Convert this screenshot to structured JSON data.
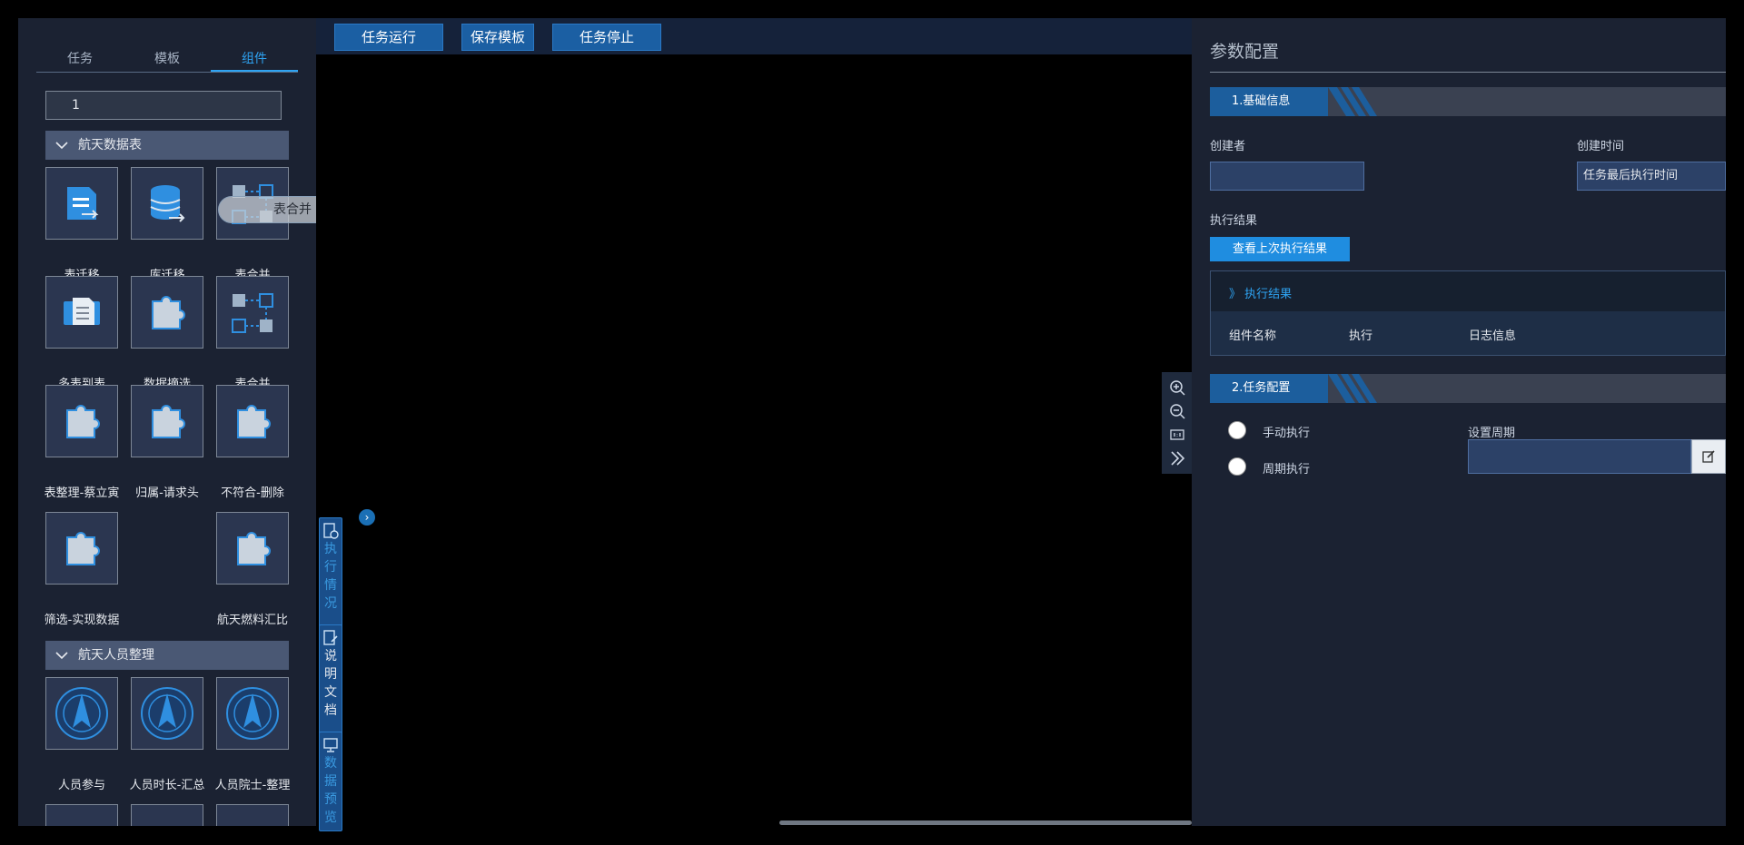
{
  "left_panel": {
    "tabs": [
      {
        "label": "任务"
      },
      {
        "label": "模板"
      },
      {
        "label": "组件"
      }
    ],
    "search_value": "1",
    "groups": [
      {
        "title": "航天数据表"
      },
      {
        "title": "航天人员整理"
      }
    ],
    "components": [
      {
        "label": "表迁移",
        "icon": "table-migrate-icon"
      },
      {
        "label": "库迁移",
        "icon": "database-migrate-icon"
      },
      {
        "label": "表合并",
        "icon": "table-merge-icon"
      },
      {
        "label": "多表到表",
        "icon": "multi-table-icon"
      },
      {
        "label": "数据摘选",
        "icon": "puzzle-icon"
      },
      {
        "label": "表合并",
        "icon": "table-merge-icon"
      },
      {
        "label": "表整理-蔡立寅",
        "icon": "puzzle-icon"
      },
      {
        "label": "归属-请求头",
        "icon": "puzzle-icon"
      },
      {
        "label": "不符合-删除",
        "icon": "puzzle-icon"
      },
      {
        "label": "筛选-实现数据",
        "icon": "puzzle-icon"
      },
      {
        "label": "航天燃料汇比",
        "icon": "puzzle-icon"
      }
    ],
    "people_components": [
      {
        "label": "人员参与",
        "icon": "casc-logo-icon"
      },
      {
        "label": "人员时长-汇总",
        "icon": "casc-logo-icon"
      },
      {
        "label": "人员院士-整理",
        "icon": "casc-logo-icon"
      }
    ],
    "drag_ghost_label": "表合并",
    "tile_overlay_text": "表合"
  },
  "toolbar": {
    "run_label": "任务运行",
    "save_label": "保存模板",
    "stop_label": "任务停止"
  },
  "side_tabs": [
    {
      "chars": [
        "执",
        "行",
        "情",
        "况"
      ]
    },
    {
      "chars": [
        "说",
        "明",
        "文",
        "档"
      ]
    },
    {
      "chars": [
        "数",
        "据",
        "预",
        "览"
      ]
    }
  ],
  "right_panel": {
    "title": "参数配置",
    "section1": "1.基础信息",
    "creator_label": "创建者",
    "creator_value": "",
    "created_time_label": "创建时间",
    "created_time_value": "任务最后执行时间",
    "exec_result_label": "执行结果",
    "view_last_button": "查看上次执行结果",
    "result_box_title": "》 执行结果",
    "result_columns": [
      "组件名称",
      "执行",
      "日志信息"
    ],
    "section2": "2.任务配置",
    "manual_label": "手动执行",
    "periodic_label": "周期执行",
    "period_label": "设置周期",
    "period_value": ""
  },
  "colors": {
    "accent": "#2ea3f2",
    "panel_bg": "#1b2232",
    "section_blue": "#1c5e9d",
    "toolbar_button": "#1b5fa3"
  }
}
